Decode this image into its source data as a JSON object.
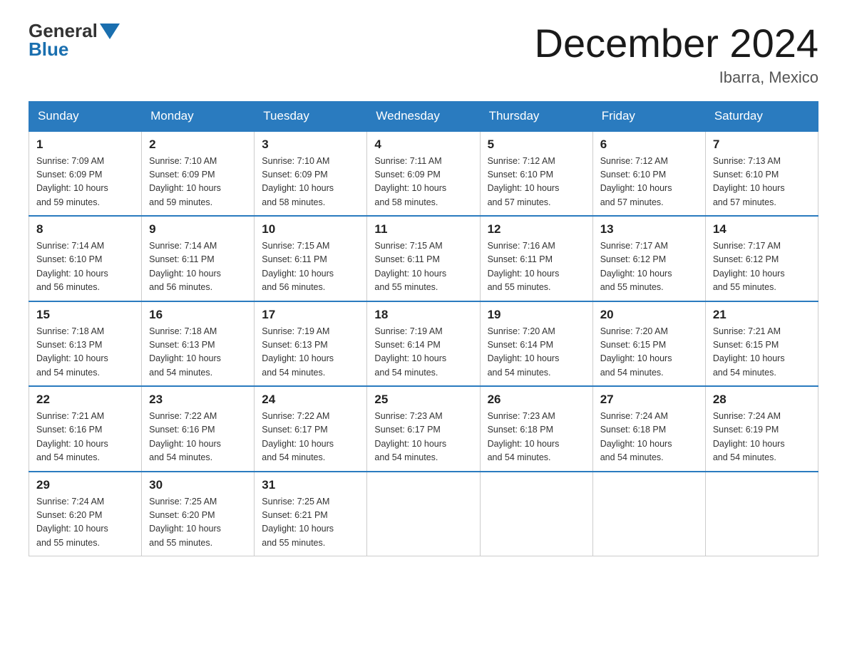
{
  "header": {
    "logo_general": "General",
    "logo_blue": "Blue",
    "month_title": "December 2024",
    "location": "Ibarra, Mexico"
  },
  "days_of_week": [
    "Sunday",
    "Monday",
    "Tuesday",
    "Wednesday",
    "Thursday",
    "Friday",
    "Saturday"
  ],
  "weeks": [
    [
      {
        "day": "1",
        "sunrise": "7:09 AM",
        "sunset": "6:09 PM",
        "daylight": "10 hours and 59 minutes."
      },
      {
        "day": "2",
        "sunrise": "7:10 AM",
        "sunset": "6:09 PM",
        "daylight": "10 hours and 59 minutes."
      },
      {
        "day": "3",
        "sunrise": "7:10 AM",
        "sunset": "6:09 PM",
        "daylight": "10 hours and 58 minutes."
      },
      {
        "day": "4",
        "sunrise": "7:11 AM",
        "sunset": "6:09 PM",
        "daylight": "10 hours and 58 minutes."
      },
      {
        "day": "5",
        "sunrise": "7:12 AM",
        "sunset": "6:10 PM",
        "daylight": "10 hours and 57 minutes."
      },
      {
        "day": "6",
        "sunrise": "7:12 AM",
        "sunset": "6:10 PM",
        "daylight": "10 hours and 57 minutes."
      },
      {
        "day": "7",
        "sunrise": "7:13 AM",
        "sunset": "6:10 PM",
        "daylight": "10 hours and 57 minutes."
      }
    ],
    [
      {
        "day": "8",
        "sunrise": "7:14 AM",
        "sunset": "6:10 PM",
        "daylight": "10 hours and 56 minutes."
      },
      {
        "day": "9",
        "sunrise": "7:14 AM",
        "sunset": "6:11 PM",
        "daylight": "10 hours and 56 minutes."
      },
      {
        "day": "10",
        "sunrise": "7:15 AM",
        "sunset": "6:11 PM",
        "daylight": "10 hours and 56 minutes."
      },
      {
        "day": "11",
        "sunrise": "7:15 AM",
        "sunset": "6:11 PM",
        "daylight": "10 hours and 55 minutes."
      },
      {
        "day": "12",
        "sunrise": "7:16 AM",
        "sunset": "6:11 PM",
        "daylight": "10 hours and 55 minutes."
      },
      {
        "day": "13",
        "sunrise": "7:17 AM",
        "sunset": "6:12 PM",
        "daylight": "10 hours and 55 minutes."
      },
      {
        "day": "14",
        "sunrise": "7:17 AM",
        "sunset": "6:12 PM",
        "daylight": "10 hours and 55 minutes."
      }
    ],
    [
      {
        "day": "15",
        "sunrise": "7:18 AM",
        "sunset": "6:13 PM",
        "daylight": "10 hours and 54 minutes."
      },
      {
        "day": "16",
        "sunrise": "7:18 AM",
        "sunset": "6:13 PM",
        "daylight": "10 hours and 54 minutes."
      },
      {
        "day": "17",
        "sunrise": "7:19 AM",
        "sunset": "6:13 PM",
        "daylight": "10 hours and 54 minutes."
      },
      {
        "day": "18",
        "sunrise": "7:19 AM",
        "sunset": "6:14 PM",
        "daylight": "10 hours and 54 minutes."
      },
      {
        "day": "19",
        "sunrise": "7:20 AM",
        "sunset": "6:14 PM",
        "daylight": "10 hours and 54 minutes."
      },
      {
        "day": "20",
        "sunrise": "7:20 AM",
        "sunset": "6:15 PM",
        "daylight": "10 hours and 54 minutes."
      },
      {
        "day": "21",
        "sunrise": "7:21 AM",
        "sunset": "6:15 PM",
        "daylight": "10 hours and 54 minutes."
      }
    ],
    [
      {
        "day": "22",
        "sunrise": "7:21 AM",
        "sunset": "6:16 PM",
        "daylight": "10 hours and 54 minutes."
      },
      {
        "day": "23",
        "sunrise": "7:22 AM",
        "sunset": "6:16 PM",
        "daylight": "10 hours and 54 minutes."
      },
      {
        "day": "24",
        "sunrise": "7:22 AM",
        "sunset": "6:17 PM",
        "daylight": "10 hours and 54 minutes."
      },
      {
        "day": "25",
        "sunrise": "7:23 AM",
        "sunset": "6:17 PM",
        "daylight": "10 hours and 54 minutes."
      },
      {
        "day": "26",
        "sunrise": "7:23 AM",
        "sunset": "6:18 PM",
        "daylight": "10 hours and 54 minutes."
      },
      {
        "day": "27",
        "sunrise": "7:24 AM",
        "sunset": "6:18 PM",
        "daylight": "10 hours and 54 minutes."
      },
      {
        "day": "28",
        "sunrise": "7:24 AM",
        "sunset": "6:19 PM",
        "daylight": "10 hours and 54 minutes."
      }
    ],
    [
      {
        "day": "29",
        "sunrise": "7:24 AM",
        "sunset": "6:20 PM",
        "daylight": "10 hours and 55 minutes."
      },
      {
        "day": "30",
        "sunrise": "7:25 AM",
        "sunset": "6:20 PM",
        "daylight": "10 hours and 55 minutes."
      },
      {
        "day": "31",
        "sunrise": "7:25 AM",
        "sunset": "6:21 PM",
        "daylight": "10 hours and 55 minutes."
      },
      null,
      null,
      null,
      null
    ]
  ],
  "labels": {
    "sunrise_prefix": "Sunrise: ",
    "sunset_prefix": "Sunset: ",
    "daylight_prefix": "Daylight: "
  }
}
